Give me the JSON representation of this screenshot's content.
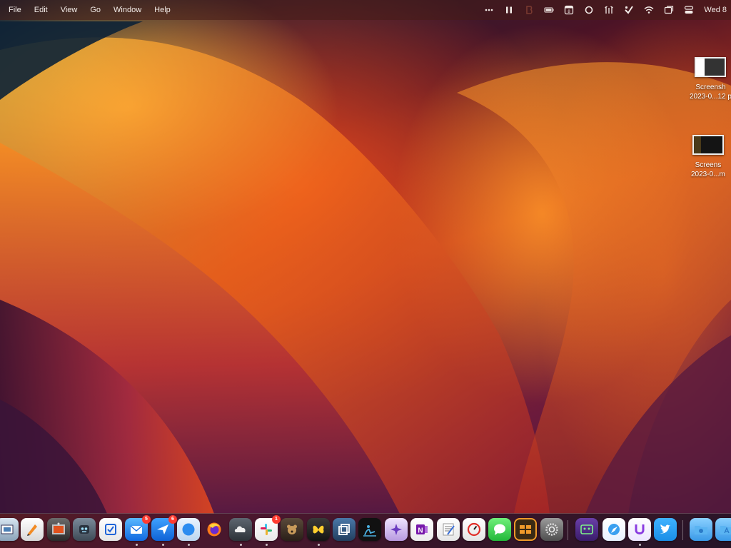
{
  "menubar": {
    "menus": [
      "File",
      "Edit",
      "View",
      "Go",
      "Window",
      "Help"
    ],
    "status_icons": [
      "more-icon",
      "pause-icon",
      "bartender-icon",
      "battery-icon",
      "calendar-icon",
      "record-icon",
      "antenna-icon",
      "vpn-check-icon",
      "wifi-icon",
      "window-icon",
      "control-center-icon"
    ],
    "calendar_day": "8",
    "clock": "Wed 8"
  },
  "desktop_files": [
    {
      "line1": "Screensh",
      "line2": "2023-0...12 p"
    },
    {
      "line1": "Screens",
      "line2": "2023-0...m"
    }
  ],
  "dock": {
    "items": [
      {
        "name": "preview",
        "badge": "",
        "running": false
      },
      {
        "name": "pages",
        "badge": "",
        "running": false
      },
      {
        "name": "photo-booth",
        "badge": "",
        "running": false
      },
      {
        "name": "terminal-robot",
        "badge": "",
        "running": false
      },
      {
        "name": "reminders",
        "badge": "",
        "running": false
      },
      {
        "name": "mail",
        "badge": "5",
        "running": true
      },
      {
        "name": "airmail",
        "badge": "6",
        "running": true
      },
      {
        "name": "safari",
        "badge": "",
        "running": true
      },
      {
        "name": "firefox",
        "badge": "",
        "running": false
      },
      {
        "name": "cloud",
        "badge": "",
        "running": true
      },
      {
        "name": "slack",
        "badge": "1",
        "running": true
      },
      {
        "name": "bear",
        "badge": "",
        "running": false
      },
      {
        "name": "tes",
        "badge": "",
        "running": true
      },
      {
        "name": "window-manager",
        "badge": "",
        "running": false
      },
      {
        "name": "kindle",
        "badge": "",
        "running": false
      },
      {
        "name": "dictionary",
        "badge": "",
        "running": false
      },
      {
        "name": "onenote",
        "badge": "",
        "running": false
      },
      {
        "name": "textedit",
        "badge": "",
        "running": false
      },
      {
        "name": "speedtest",
        "badge": "",
        "running": false
      },
      {
        "name": "messages",
        "badge": "",
        "running": false
      },
      {
        "name": "reeder",
        "badge": "",
        "running": false
      },
      {
        "name": "system-settings",
        "badge": "",
        "running": false
      },
      {
        "name": "screen-tool",
        "badge": "",
        "running": false
      },
      {
        "name": "compass",
        "badge": "",
        "running": false
      },
      {
        "name": "u-app",
        "badge": "",
        "running": true
      },
      {
        "name": "twitter",
        "badge": "",
        "running": false
      },
      {
        "name": "downloads-folder",
        "badge": "",
        "running": false
      },
      {
        "name": "applications-folder",
        "badge": "",
        "running": false
      }
    ]
  }
}
